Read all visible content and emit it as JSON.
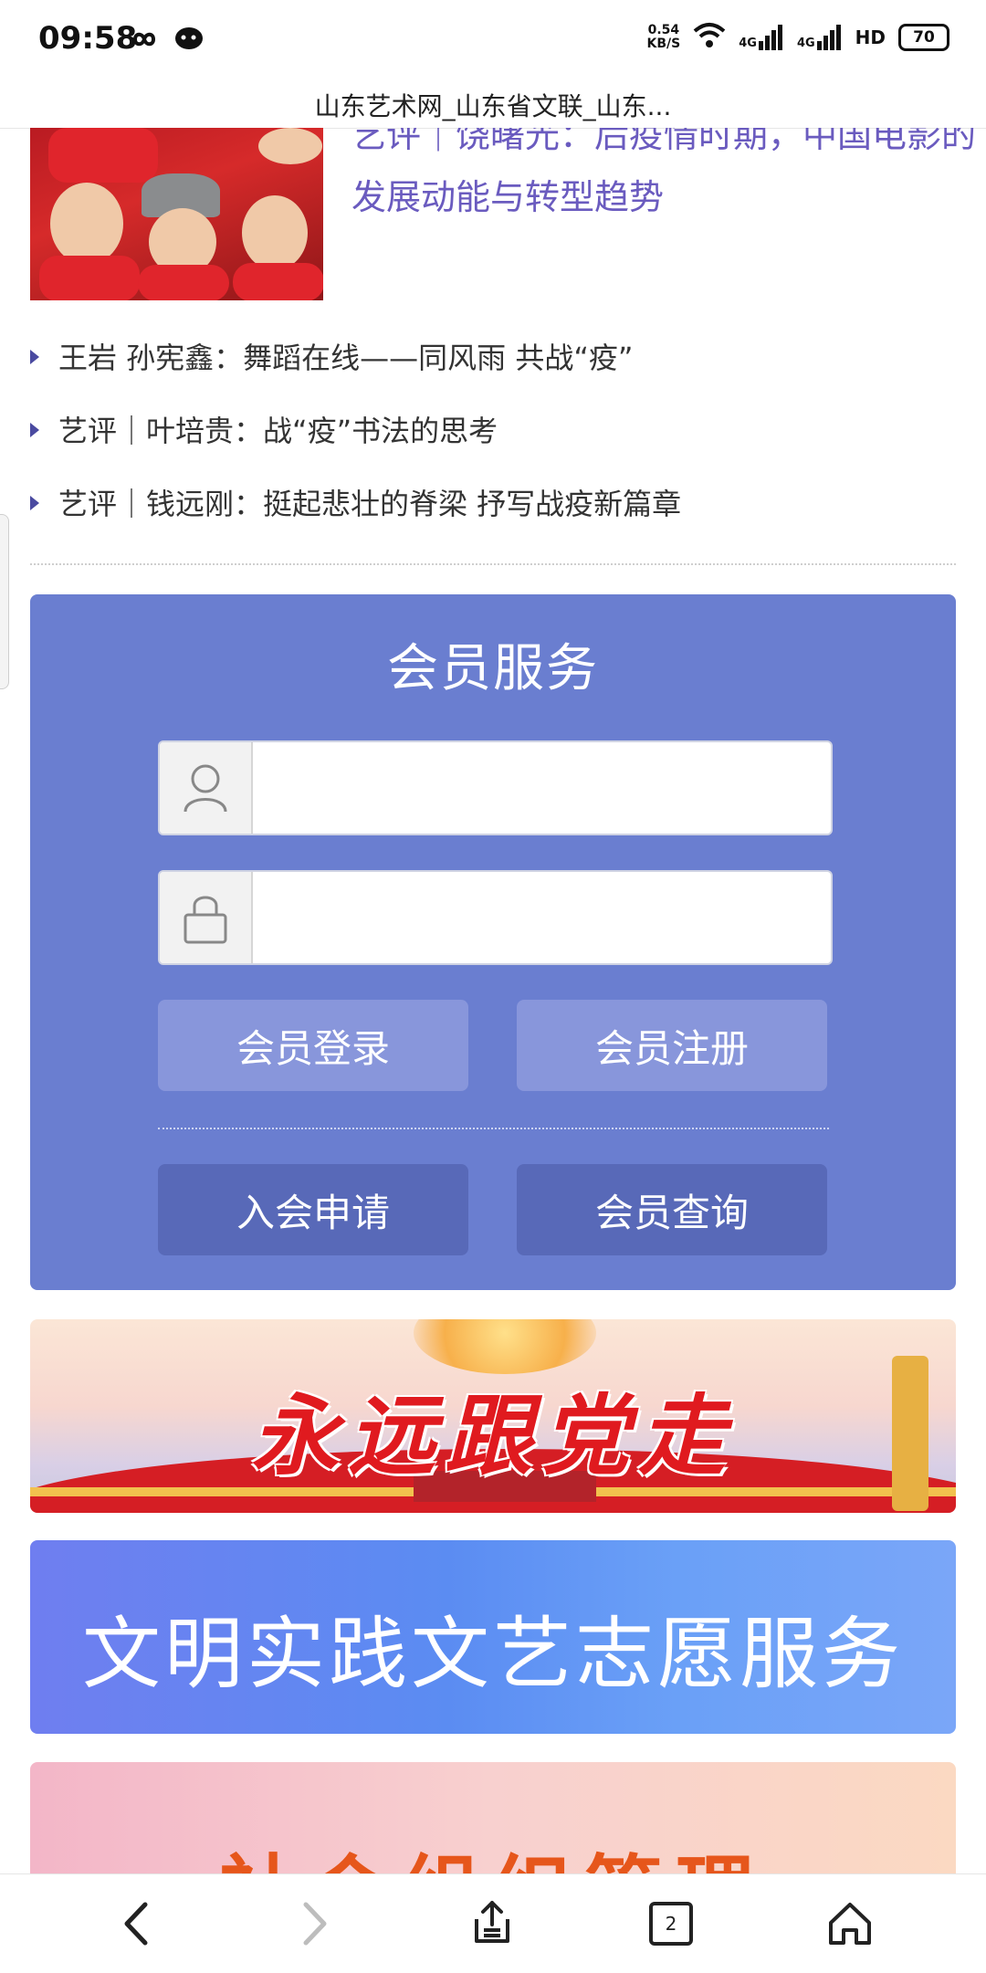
{
  "status_bar": {
    "time": "09:58",
    "net_speed_value": "0.54",
    "net_speed_unit": "KB/S",
    "signal1_label": "4G",
    "signal2_label": "4G",
    "hd_label": "HD",
    "battery": "70"
  },
  "browser": {
    "page_title": "山东艺术网_山东省文联_山东..."
  },
  "featured": {
    "title": "艺评｜饶曙光：后疫情时期，中国电影的发展动能与转型趋势"
  },
  "news_list": [
    "王岩 孙宪鑫：舞蹈在线——同风雨 共战“疫”",
    "艺评｜叶培贵：战“疫”书法的思考",
    "艺评｜钱远刚：挺起悲壮的脊梁 抒写战疫新篇章"
  ],
  "member_service": {
    "title": "会员服务",
    "username_placeholder": "",
    "password_placeholder": "",
    "login_label": "会员登录",
    "register_label": "会员注册",
    "apply_label": "入会申请",
    "query_label": "会员查询"
  },
  "banners": {
    "party": "永远跟党走",
    "volunteer": "文明实践文艺志愿服务",
    "social": "社会组织管理"
  },
  "bottom_nav": {
    "tab_count": "2"
  },
  "colors": {
    "member_bg": "#6a7ed0",
    "title_purple": "#6a5bbf",
    "button_light": "#8896db",
    "button_dark": "#5869b8"
  }
}
